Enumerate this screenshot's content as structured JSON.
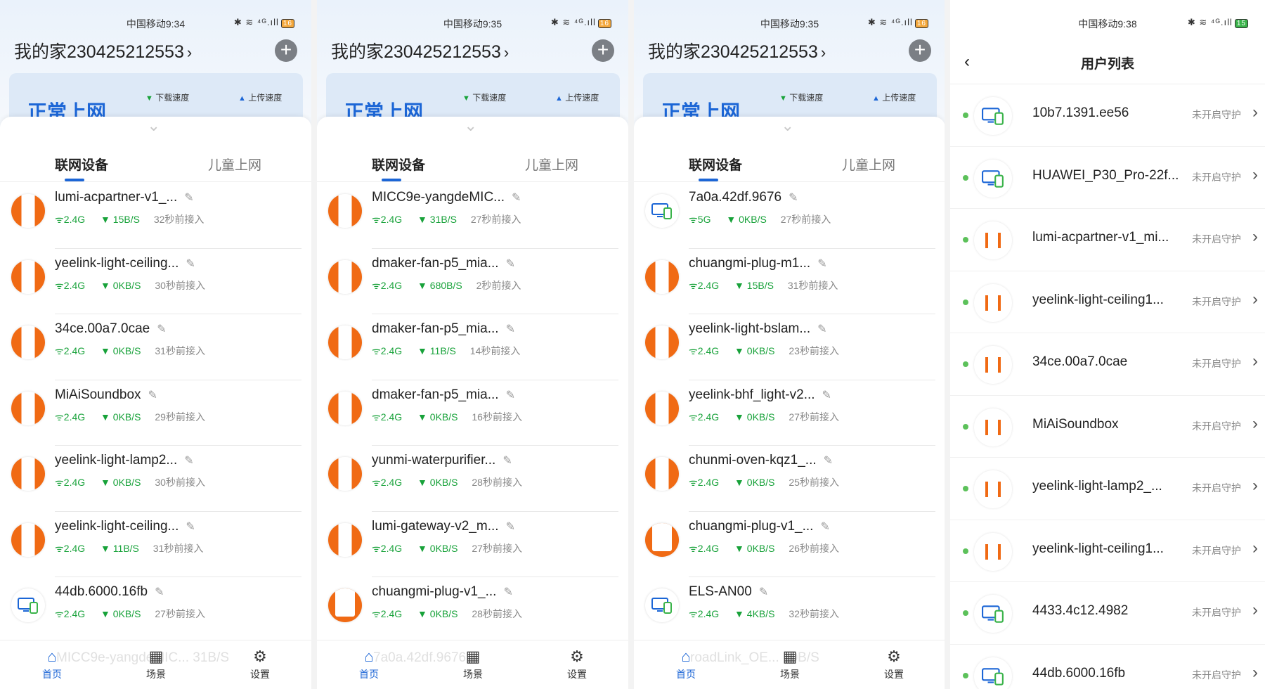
{
  "status_times": [
    "中国移动9:34",
    "中国移动9:35",
    "中国移动9:35",
    "中国移动9:38"
  ],
  "status_icons": "✱ ≋ ⁴ᴳ.ıll",
  "batteries": [
    "16",
    "16",
    "16",
    "15"
  ],
  "home": {
    "title": "我的家230425212553",
    "net_status": "正常上网",
    "download_label": "下载速度",
    "upload_label": "上传速度"
  },
  "tabs": {
    "devices": "联网设备",
    "kids": "儿童上网"
  },
  "nav": {
    "home": "首页",
    "scene": "场景",
    "settings": "设置"
  },
  "panels": [
    {
      "devices": [
        {
          "icon": "orange",
          "name": "lumi-acpartner-v1_...",
          "band": "2.4G",
          "speed": "15B/S",
          "time": "32秒前接入"
        },
        {
          "icon": "orange",
          "name": "yeelink-light-ceiling...",
          "band": "2.4G",
          "speed": "0KB/S",
          "time": "30秒前接入"
        },
        {
          "icon": "orange",
          "name": "34ce.00a7.0cae",
          "band": "2.4G",
          "speed": "0KB/S",
          "time": "31秒前接入"
        },
        {
          "icon": "orange",
          "name": "MiAiSoundbox",
          "band": "2.4G",
          "speed": "0KB/S",
          "time": "29秒前接入"
        },
        {
          "icon": "orange",
          "name": "yeelink-light-lamp2...",
          "band": "2.4G",
          "speed": "0KB/S",
          "time": "30秒前接入"
        },
        {
          "icon": "orange",
          "name": "yeelink-light-ceiling...",
          "band": "2.4G",
          "speed": "11B/S",
          "time": "31秒前接入"
        },
        {
          "icon": "pc",
          "name": "44db.6000.16fb",
          "band": "2.4G",
          "speed": "0KB/S",
          "time": "27秒前接入"
        }
      ],
      "ghost": "MICC9e-yangdeMIC...  31B/S"
    },
    {
      "devices": [
        {
          "icon": "orange",
          "name": "MICC9e-yangdeMIC...",
          "band": "2.4G",
          "speed": "31B/S",
          "time": "27秒前接入"
        },
        {
          "icon": "orange",
          "name": "dmaker-fan-p5_mia...",
          "band": "2.4G",
          "speed": "680B/S",
          "time": "2秒前接入"
        },
        {
          "icon": "orange",
          "name": "dmaker-fan-p5_mia...",
          "band": "2.4G",
          "speed": "11B/S",
          "time": "14秒前接入"
        },
        {
          "icon": "orange",
          "name": "dmaker-fan-p5_mia...",
          "band": "2.4G",
          "speed": "0KB/S",
          "time": "16秒前接入"
        },
        {
          "icon": "orange",
          "name": "yunmi-waterpurifier...",
          "band": "2.4G",
          "speed": "0KB/S",
          "time": "28秒前接入"
        },
        {
          "icon": "orange",
          "name": "lumi-gateway-v2_m...",
          "band": "2.4G",
          "speed": "0KB/S",
          "time": "27秒前接入"
        },
        {
          "icon": "orange-u",
          "name": "chuangmi-plug-v1_...",
          "band": "2.4G",
          "speed": "0KB/S",
          "time": "28秒前接入"
        }
      ],
      "ghost": "7a0a.42df.9676"
    },
    {
      "devices": [
        {
          "icon": "pc",
          "name": "7a0a.42df.9676",
          "band": "5G",
          "speed": "0KB/S",
          "time": "27秒前接入"
        },
        {
          "icon": "orange",
          "name": "chuangmi-plug-m1...",
          "band": "2.4G",
          "speed": "15B/S",
          "time": "31秒前接入"
        },
        {
          "icon": "orange",
          "name": "yeelink-light-bslam...",
          "band": "2.4G",
          "speed": "0KB/S",
          "time": "23秒前接入"
        },
        {
          "icon": "orange",
          "name": "yeelink-bhf_light-v2...",
          "band": "2.4G",
          "speed": "0KB/S",
          "time": "27秒前接入"
        },
        {
          "icon": "orange",
          "name": "chunmi-oven-kqz1_...",
          "band": "2.4G",
          "speed": "0KB/S",
          "time": "25秒前接入"
        },
        {
          "icon": "orange-u",
          "name": "chuangmi-plug-v1_...",
          "band": "2.4G",
          "speed": "0KB/S",
          "time": "26秒前接入"
        },
        {
          "icon": "pc",
          "name": "ELS-AN00",
          "band": "2.4G",
          "speed": "4KB/S",
          "time": "32秒前接入"
        }
      ],
      "ghost": "roadLink_OE...  10B/S"
    }
  ],
  "user_list": {
    "title": "用户列表",
    "guard_label": "未开启守护",
    "users": [
      {
        "icon": "pc",
        "name": "10b7.1391.ee56"
      },
      {
        "icon": "pc",
        "name": "HUAWEI_P30_Pro-22f..."
      },
      {
        "icon": "bars",
        "name": "lumi-acpartner-v1_mi..."
      },
      {
        "icon": "bars",
        "name": "yeelink-light-ceiling1..."
      },
      {
        "icon": "bars",
        "name": "34ce.00a7.0cae"
      },
      {
        "icon": "bars",
        "name": "MiAiSoundbox"
      },
      {
        "icon": "bars",
        "name": "yeelink-light-lamp2_..."
      },
      {
        "icon": "bars",
        "name": "yeelink-light-ceiling1..."
      },
      {
        "icon": "pc",
        "name": "4433.4c12.4982"
      },
      {
        "icon": "pc",
        "name": "44db.6000.16fb"
      }
    ]
  }
}
